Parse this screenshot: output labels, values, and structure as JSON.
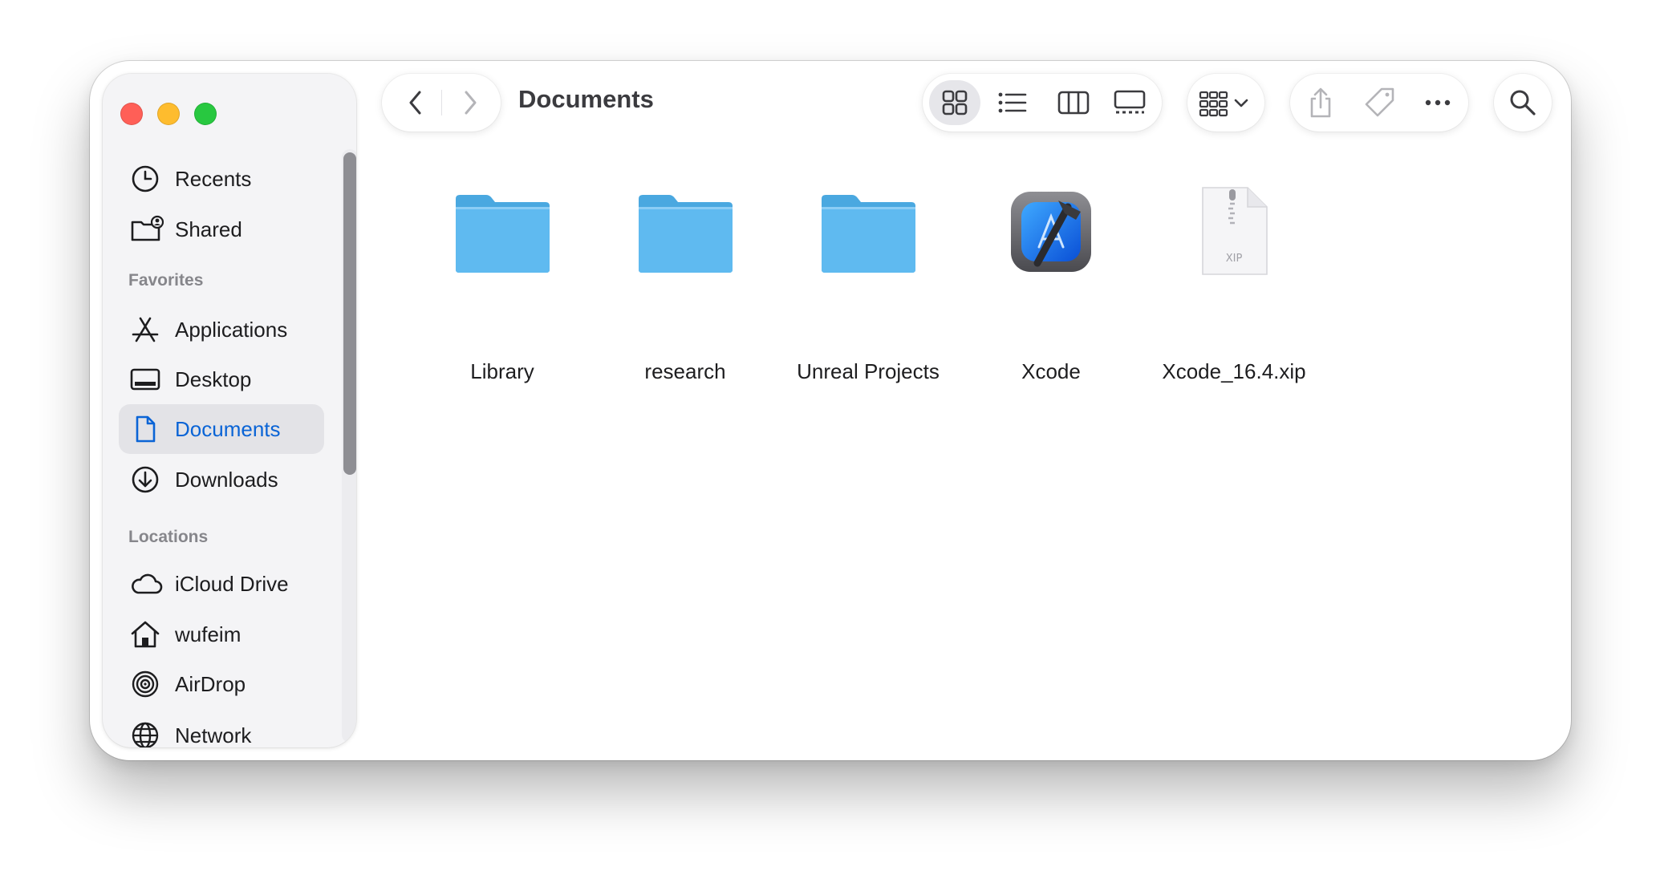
{
  "window": {
    "title": "Documents"
  },
  "toolbar": {
    "back_icon": "chevron-left-icon",
    "forward_icon": "chevron-right-icon",
    "views": [
      "icon-view",
      "list-view",
      "column-view",
      "gallery-view"
    ],
    "selected_view": "icon-view",
    "group_icon": "grid-with-chevron-icon",
    "share_icon": "share-icon",
    "tag_icon": "tag-icon",
    "more_icon": "ellipsis-icon",
    "search_icon": "magnifying-glass-icon"
  },
  "sidebar": {
    "top_items": [
      {
        "label": "Recents",
        "icon": "clock-icon"
      },
      {
        "label": "Shared",
        "icon": "shared-folder-icon"
      }
    ],
    "favorites_label": "Favorites",
    "favorites": [
      {
        "label": "Applications",
        "icon": "applications-icon"
      },
      {
        "label": "Desktop",
        "icon": "desktop-icon"
      },
      {
        "label": "Documents",
        "icon": "document-icon",
        "selected": true
      },
      {
        "label": "Downloads",
        "icon": "download-icon"
      }
    ],
    "locations_label": "Locations",
    "locations": [
      {
        "label": "iCloud Drive",
        "icon": "cloud-icon"
      },
      {
        "label": "wufeim",
        "icon": "home-icon"
      },
      {
        "label": "AirDrop",
        "icon": "airdrop-icon"
      },
      {
        "label": "Network",
        "icon": "globe-icon"
      }
    ]
  },
  "files": [
    {
      "name": "Library",
      "kind": "folder"
    },
    {
      "name": "research",
      "kind": "folder"
    },
    {
      "name": "Unreal Projects",
      "kind": "folder"
    },
    {
      "name": "Xcode",
      "kind": "app"
    },
    {
      "name": "Xcode_16.4.xip",
      "kind": "archive",
      "badge": "XIP"
    }
  ],
  "colors": {
    "accent": "#0a64d6",
    "folder": "#5ab7ee",
    "close": "#ff5f57",
    "minimize": "#febc2e",
    "zoom": "#28c840"
  }
}
